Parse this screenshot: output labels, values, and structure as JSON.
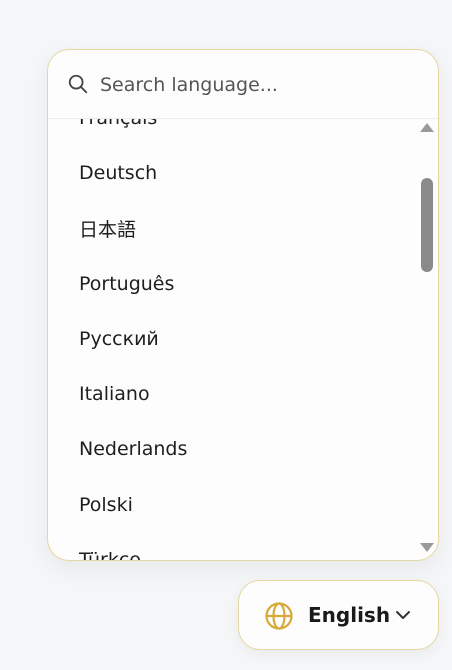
{
  "search": {
    "placeholder": "Search language..."
  },
  "languages": [
    "Français",
    "Deutsch",
    "日本語",
    "Português",
    "Русский",
    "Italiano",
    "Nederlands",
    "Polski",
    "Türkçe"
  ],
  "selector": {
    "current": "English"
  },
  "colors": {
    "accent": "#d8a93a",
    "border": "#e6d6a0"
  }
}
